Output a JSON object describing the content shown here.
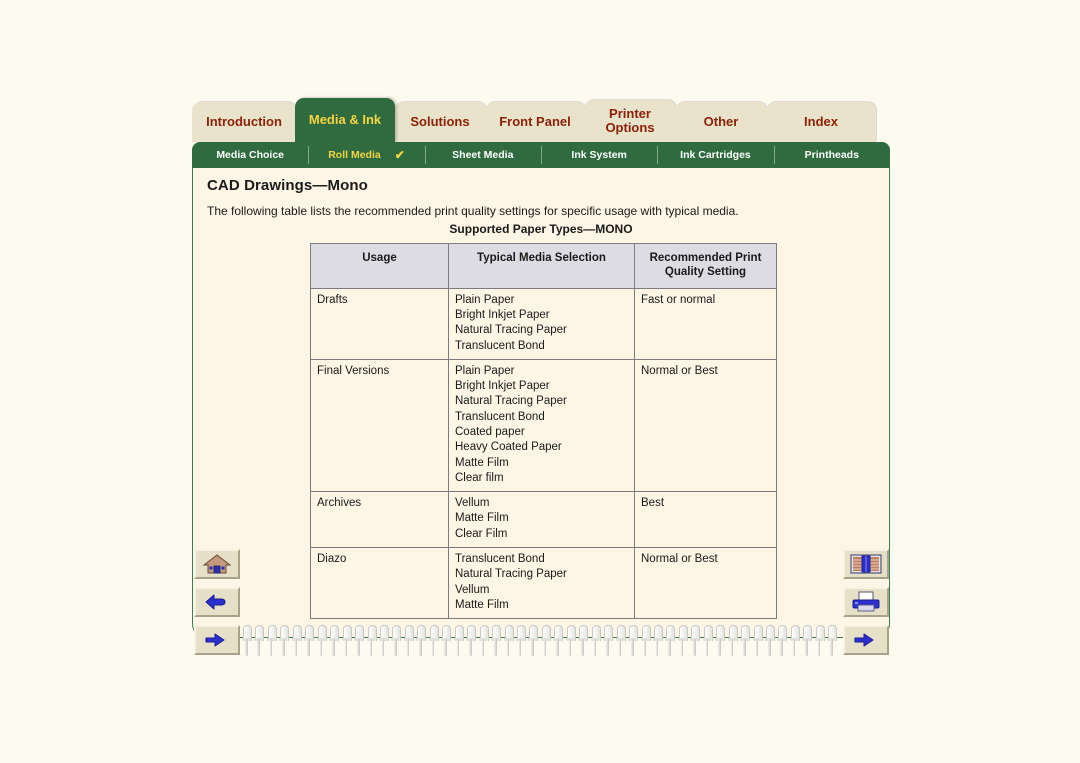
{
  "theme": {
    "page_bg": "#fdfaf0",
    "content_bg": "#fdf6e6",
    "tab_active_bg": "#2f6b3f",
    "tab_inactive_bg": "#e8e3ca",
    "tab_inactive_text": "#8c2207",
    "tab_active_text": "#f5d442",
    "table_header_bg": "#dcdce2",
    "border": "#7c7c7c"
  },
  "main_tabs": [
    {
      "label": "Introduction",
      "active": false
    },
    {
      "label": "Media & Ink",
      "active": true
    },
    {
      "label": "Solutions",
      "active": false
    },
    {
      "label": "Front Panel",
      "active": false
    },
    {
      "label": "Printer Options",
      "active": false,
      "two_line": true,
      "line1": "Printer",
      "line2": "Options"
    },
    {
      "label": "Other",
      "active": false
    },
    {
      "label": "Index",
      "active": false
    }
  ],
  "sub_tabs": [
    {
      "label": "Media Choice",
      "current": false,
      "check": ""
    },
    {
      "label": "Roll Media",
      "current": true,
      "check": "✔"
    },
    {
      "label": "Sheet Media",
      "current": false,
      "check": ""
    },
    {
      "label": "Ink System",
      "current": false,
      "check": ""
    },
    {
      "label": "Ink Cartridges",
      "current": false,
      "check": ""
    },
    {
      "label": "Printheads",
      "current": false,
      "check": ""
    }
  ],
  "content": {
    "title": "CAD Drawings—Mono",
    "intro": "The following table lists the recommended print quality settings for specific usage with typical media.",
    "table_caption": "Supported Paper Types—MONO"
  },
  "table": {
    "headers": [
      "Usage",
      "Typical Media Selection",
      "Recommended Print Quality Setting"
    ],
    "header_lines": [
      [
        "Usage"
      ],
      [
        "Typical Media Selection"
      ],
      [
        "Recommended Print",
        "Quality Setting"
      ]
    ],
    "rows": [
      {
        "usage": "Drafts",
        "media": [
          "Plain Paper",
          "Bright Inkjet Paper",
          "Natural Tracing Paper",
          "Translucent Bond"
        ],
        "quality": "Fast or normal"
      },
      {
        "usage": "Final Versions",
        "media": [
          "Plain Paper",
          "Bright Inkjet Paper",
          "Natural Tracing Paper",
          "Translucent Bond",
          "Coated paper",
          "Heavy Coated Paper",
          "Matte Film",
          "Clear film"
        ],
        "quality": "Normal or Best"
      },
      {
        "usage": "Archives",
        "media": [
          "Vellum",
          "Matte Film",
          "Clear Film"
        ],
        "quality": "Best"
      },
      {
        "usage": "Diazo",
        "media": [
          "Translucent Bond",
          "Natural Tracing Paper",
          "Vellum",
          "Matte Film"
        ],
        "quality": "Normal or Best"
      }
    ]
  },
  "nav_buttons": {
    "home": {
      "icon": "home-icon",
      "title": "Home"
    },
    "back": {
      "icon": "back-arrow-icon",
      "title": "Back"
    },
    "forward": {
      "icon": "forward-hand-icon",
      "title": "Forward"
    },
    "bookshelf": {
      "icon": "bookshelf-icon",
      "title": "Bookshelf"
    },
    "print": {
      "icon": "printer-icon",
      "title": "Print"
    },
    "next": {
      "icon": "next-hand-icon",
      "title": "Next"
    }
  }
}
